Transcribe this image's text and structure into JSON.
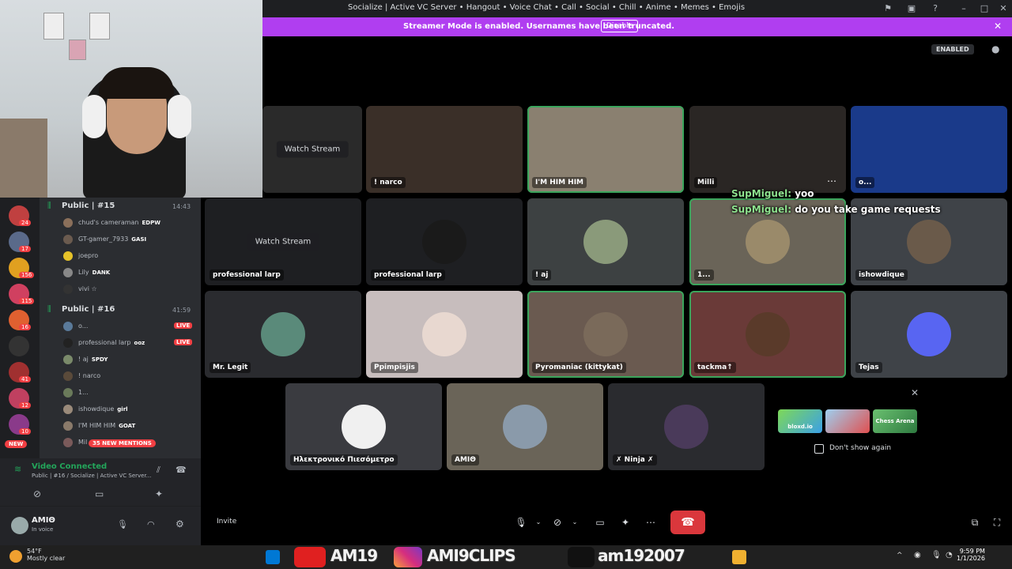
{
  "window": {
    "title": "Socialize | Active VC Server • Hangout • Voice Chat • Call • Social • Chill • Anime • Memes • Emojis"
  },
  "banner": {
    "message": "Streamer Mode is enabled. Usernames have been truncated.",
    "disable_label": "Disable"
  },
  "stage_header": {
    "enabled_label": "ENABLED"
  },
  "sidebar": {
    "servers": [
      {
        "badge": "24"
      },
      {
        "badge": "17"
      },
      {
        "badge": "156"
      },
      {
        "badge": "115"
      },
      {
        "badge": "16"
      },
      {
        "badge": ""
      },
      {
        "badge": "41"
      },
      {
        "badge": "12"
      },
      {
        "badge": "10"
      }
    ],
    "channels": [
      {
        "name": "Public | #15",
        "time": "14:43",
        "members": [
          {
            "name": "chud's cameraman",
            "tag": "EDPW",
            "color": "#8a6f5a"
          },
          {
            "name": "GT-gamer_7933",
            "tag": "GASI",
            "color": "#6b5b4f"
          },
          {
            "name": "joepro",
            "tag": "",
            "color": "#e6c229"
          },
          {
            "name": "Lily",
            "tag": "DANK",
            "color": "#888"
          },
          {
            "name": "vivi ☆",
            "tag": "",
            "color": "#333"
          }
        ]
      },
      {
        "name": "Public | #16",
        "time": "41:59",
        "members": [
          {
            "name": "o...",
            "tag": "",
            "live": "LIVE",
            "color": "#5a7a9a"
          },
          {
            "name": "professional larp",
            "tag": "ooz",
            "live": "LIVE",
            "color": "#222"
          },
          {
            "name": "! aj",
            "tag": "SPDY",
            "live": "",
            "color": "#7a8a6a"
          },
          {
            "name": "! narco",
            "tag": "",
            "live": "",
            "color": "#5a4a3a"
          },
          {
            "name": "1...",
            "tag": "",
            "live": "",
            "color": "#6a7a5a"
          },
          {
            "name": "ishowdique",
            "tag": "girl",
            "live": "",
            "color": "#9a8a7a"
          },
          {
            "name": "I'M HIM HIM",
            "tag": "GOAT",
            "live": "",
            "color": "#8a7a6a"
          },
          {
            "name": "Mil",
            "tag": "",
            "live": "",
            "color": "#7a5a5a"
          }
        ]
      }
    ],
    "new_badge": "NEW",
    "mentions": "35 NEW MENTIONS",
    "voice": {
      "status": "Video Connected",
      "channel": "Public | #16 / Socialize | Active VC Server..."
    },
    "user": {
      "name": "ΑΜΙΘ",
      "status": "In voice"
    }
  },
  "tiles": [
    {
      "label": "",
      "watch": "Watch Stream",
      "bg": "#2a2a2a"
    },
    {
      "label": "! narco",
      "watch": "",
      "bg": "#3a2f28"
    },
    {
      "label": "I'M HIM HIM",
      "watch": "",
      "bg": "#8a8070"
    },
    {
      "label": "Milli",
      "watch": "",
      "bg": "#2a2624"
    },
    {
      "label": "o...",
      "watch": "",
      "bg": "#1a3a8a"
    },
    {
      "label": "professional larp",
      "watch": "Watch Stream",
      "bg": "#1e1f22"
    },
    {
      "label": "professional larp",
      "watch": "",
      "bg": "#1e1f22"
    },
    {
      "label": "! aj",
      "watch": "",
      "bg": "#3d4142"
    },
    {
      "label": "1...",
      "watch": "",
      "bg": "#6a6458"
    },
    {
      "label": "ishowdique",
      "watch": "",
      "bg": "#3f4348"
    },
    {
      "label": "Mr. Legit",
      "watch": "",
      "bg": "#2a2b2f"
    },
    {
      "label": "Ppimpisjis",
      "watch": "",
      "bg": "#c7bdbd"
    },
    {
      "label": "Pyromaniac (kittykat)",
      "watch": "",
      "bg": "#6a5a50"
    },
    {
      "label": "tackma↑",
      "watch": "",
      "bg": "#6a3a38"
    },
    {
      "label": "Tejas",
      "watch": "",
      "bg": "#3f4348"
    },
    {
      "label": "Ηλεκτρονικό Πιεσόμετρο",
      "watch": "",
      "bg": "#3a3b40"
    },
    {
      "label": "ΑΜΙΘ",
      "watch": "",
      "bg": "#6a6458"
    },
    {
      "label": "✗ Ninja ✗",
      "watch": "",
      "bg": "#2a2b2f"
    }
  ],
  "chat_overlay": [
    {
      "user": "SupMiguel:",
      "text": "yoo"
    },
    {
      "user": "SupMiguel:",
      "text": "do you take game requests"
    }
  ],
  "game_popup": {
    "games": [
      "bloxd.io",
      "",
      "Chess Arena"
    ],
    "dont_show": "Don't show again"
  },
  "toolbar": {
    "invite": "Invite"
  },
  "taskbar": {
    "temp": "54°F",
    "weather": "Mostly clear",
    "overlay1": "AM19",
    "overlay2": "AMI9CLIPS",
    "overlay3": "am192007",
    "time": "9:59 PM",
    "date": "1/1/2026"
  }
}
